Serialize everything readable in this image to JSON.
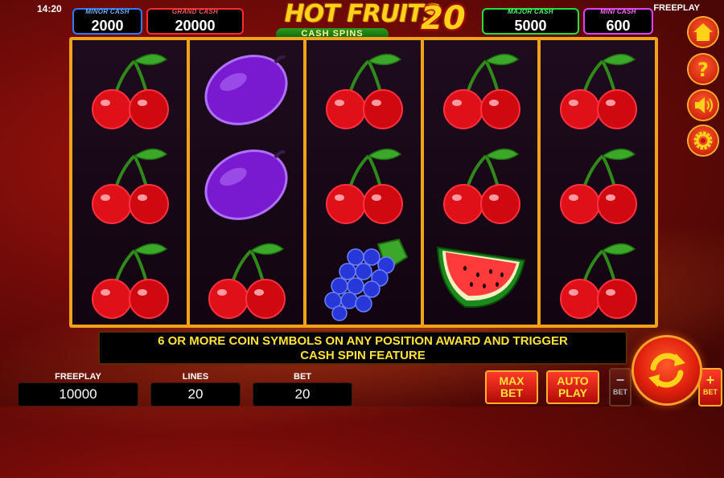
{
  "status": {
    "clock": "14:20",
    "mode": "FREEPLAY"
  },
  "jackpots": [
    {
      "id": "minor",
      "label": "MINOR CASH",
      "value": "2000",
      "color": "#2f7bff"
    },
    {
      "id": "grand",
      "label": "GRAND CASH",
      "value": "20000",
      "color": "#ff2a2a"
    },
    {
      "id": "major",
      "label": "MAJOR CASH",
      "value": "5000",
      "color": "#20e040"
    },
    {
      "id": "mini",
      "label": "MINI CASH",
      "value": "600",
      "color": "#e040ff"
    }
  ],
  "logo": {
    "title": "HOT FRUITS",
    "number": "20",
    "subtitle": "CASH SPINS"
  },
  "reels": [
    [
      "cherry",
      "cherry",
      "cherry"
    ],
    [
      "plum",
      "plum",
      "cherry"
    ],
    [
      "cherry",
      "cherry",
      "grapes"
    ],
    [
      "cherry",
      "cherry",
      "watermelon"
    ],
    [
      "cherry",
      "cherry",
      "cherry"
    ]
  ],
  "info_message": {
    "line1": "6 OR MORE COIN SYMBOLS ON ANY POSITION AWARD AND TRIGGER",
    "line2": "CASH SPIN FEATURE"
  },
  "stats": {
    "freeplay_label": "FREEPLAY",
    "freeplay_value": "10000",
    "lines_label": "LINES",
    "lines_value": "20",
    "bet_label": "BET",
    "bet_value": "20"
  },
  "buttons": {
    "maxbet_line1": "MAX",
    "maxbet_line2": "BET",
    "auto_line1": "AUTO",
    "auto_line2": "PLAY",
    "minus_sign": "−",
    "minus_label": "BET",
    "plus_sign": "+",
    "plus_label": "BET"
  },
  "side_menu": [
    "home-icon",
    "help-icon",
    "sound-icon",
    "settings-icon"
  ],
  "colors": {
    "frame": "#f0a21a",
    "accent_yellow": "#ffe23a",
    "button_red": "#e0200c"
  }
}
